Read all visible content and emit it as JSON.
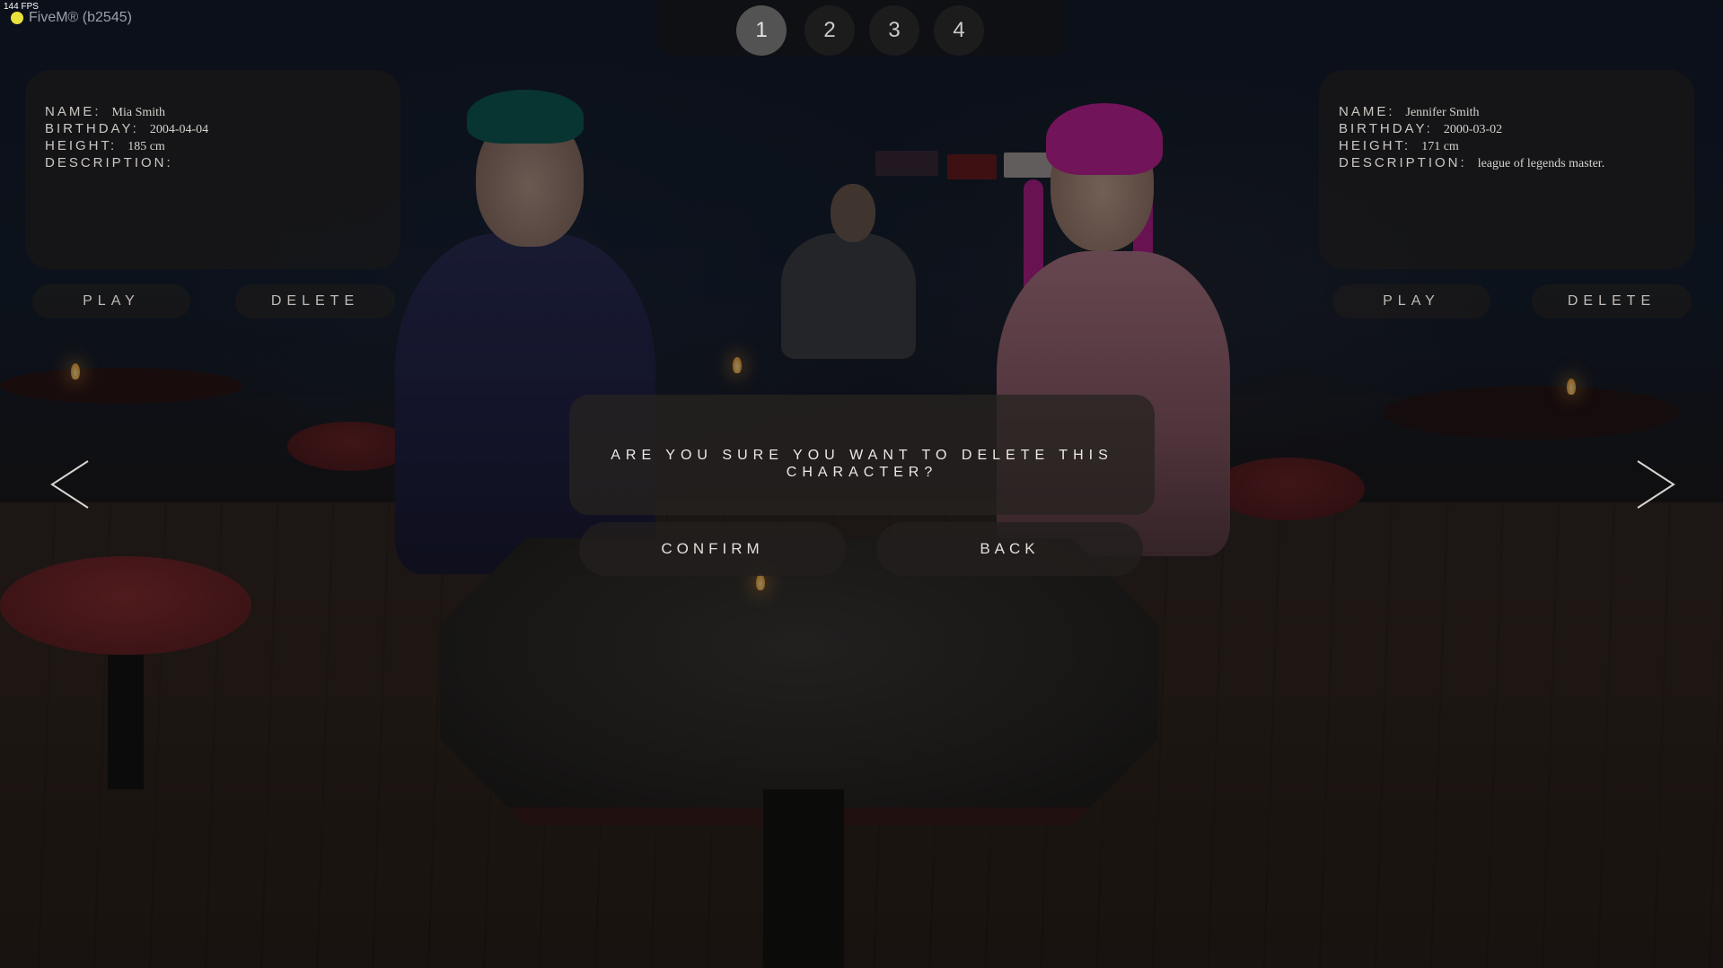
{
  "window": {
    "fps": "144 FPS",
    "title": "FiveM® (b2545)"
  },
  "pages": {
    "tabs": [
      "1",
      "2",
      "3",
      "4"
    ],
    "active": "1"
  },
  "characters": {
    "left": {
      "name_label": "NAME:",
      "name": "Mia Smith",
      "birthday_label": "BIRTHDAY:",
      "birthday": "2004-04-04",
      "height_label": "HEIGHT:",
      "height": "185 cm",
      "description_label": "DESCRIPTION:",
      "description": "",
      "play_label": "PLAY",
      "delete_label": "DELETE"
    },
    "right": {
      "name_label": "NAME:",
      "name": "Jennifer Smith",
      "birthday_label": "BIRTHDAY:",
      "birthday": "2000-03-02",
      "height_label": "HEIGHT:",
      "height": "171 cm",
      "description_label": "DESCRIPTION:",
      "description": "league of legends master.",
      "play_label": "PLAY",
      "delete_label": "DELETE"
    }
  },
  "navigation": {
    "prev_icon": "chevron-left-icon",
    "next_icon": "chevron-right-icon"
  },
  "dialog": {
    "question": "ARE YOU SURE YOU WANT TO DELETE THIS CHARACTER?",
    "confirm_label": "CONFIRM",
    "back_label": "BACK"
  },
  "colors": {
    "panel_bg": "#1c1816",
    "accent_active_tab": "#8c8a88",
    "text": "#d9d6d2"
  }
}
